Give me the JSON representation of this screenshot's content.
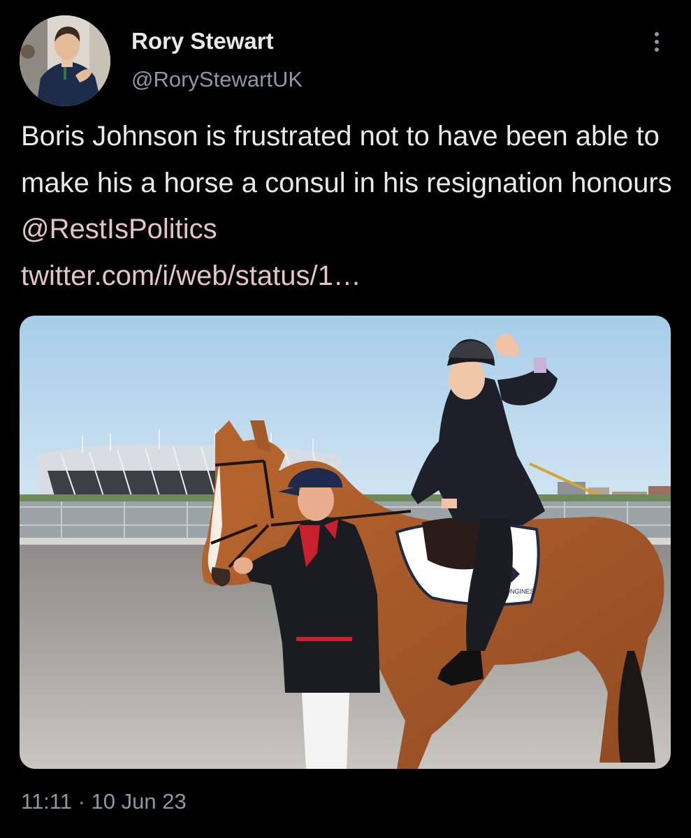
{
  "author": {
    "display_name": "Rory Stewart",
    "handle": "@RoryStewartUK",
    "avatar_icon": "profile-photo"
  },
  "menu": {
    "icon": "more-options-icon"
  },
  "tweet": {
    "text_plain": "Boris Johnson is frustrated not to have been able to make his a horse a consul in his resignation honours ",
    "mention": "@RestIsPolitics",
    "link": "twitter.com/i/web/status/1…"
  },
  "media": {
    "saddle_cloth_text": "LONGINES"
  },
  "meta": {
    "timestamp": "11:11 · 10 Jun 23"
  },
  "colors": {
    "background": "#000000",
    "primary_text": "#e7e9ea",
    "secondary_text": "#8b98a5",
    "link_text": "#e5c4c8"
  }
}
